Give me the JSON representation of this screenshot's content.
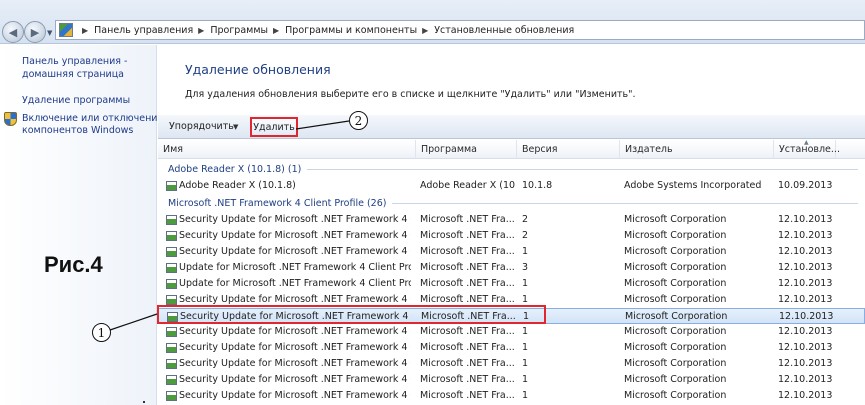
{
  "address_bar": {
    "breadcrumbs": [
      "Панель управления",
      "Программы",
      "Программы и компоненты",
      "Установленные обновления"
    ]
  },
  "sidebar": {
    "home_line1": "Панель управления -",
    "home_line2": "домашняя страница",
    "uninstall": "Удаление программы",
    "features_line1": "Включение или отключение",
    "features_line2": "компонентов Windows"
  },
  "figure_label": "Рис.4",
  "main": {
    "title": "Удаление обновления",
    "description": "Для удаления обновления выберите его в списке и щелкните \"Удалить\" или \"Изменить\"."
  },
  "toolbar": {
    "organize_label": "Упорядочить",
    "delete_label": "Удалить"
  },
  "columns": {
    "name": "Имя",
    "program": "Программа",
    "version": "Версия",
    "publisher": "Издатель",
    "installed": "Установле..."
  },
  "groups": [
    {
      "label": "Adobe Reader X (10.1.8) (1)",
      "rows": [
        {
          "name": "Adobe Reader X (10.1.8)",
          "program": "Adobe Reader X (10...",
          "version": "10.1.8",
          "publisher": "Adobe Systems Incorporated",
          "installed": "10.09.2013"
        }
      ]
    },
    {
      "label": "Microsoft .NET Framework 4 Client Profile (26)",
      "rows": [
        {
          "name": "Security Update for Microsoft .NET Framework 4 Clie...",
          "program": "Microsoft .NET Fra...",
          "version": "2",
          "publisher": "Microsoft Corporation",
          "installed": "12.10.2013"
        },
        {
          "name": "Security Update for Microsoft .NET Framework 4 Clie...",
          "program": "Microsoft .NET Fra...",
          "version": "2",
          "publisher": "Microsoft Corporation",
          "installed": "12.10.2013"
        },
        {
          "name": "Security Update for Microsoft .NET Framework 4 Clie...",
          "program": "Microsoft .NET Fra...",
          "version": "1",
          "publisher": "Microsoft Corporation",
          "installed": "12.10.2013"
        },
        {
          "name": "Update for Microsoft .NET Framework 4 Client Profile...",
          "program": "Microsoft .NET Fra...",
          "version": "3",
          "publisher": "Microsoft Corporation",
          "installed": "12.10.2013"
        },
        {
          "name": "Update for Microsoft .NET Framework 4 Client Profile...",
          "program": "Microsoft .NET Fra...",
          "version": "1",
          "publisher": "Microsoft Corporation",
          "installed": "12.10.2013"
        },
        {
          "name": "Security Update for Microsoft .NET Framework 4 Clie...",
          "program": "Microsoft .NET Fra...",
          "version": "1",
          "publisher": "Microsoft Corporation",
          "installed": "12.10.2013"
        },
        {
          "name": "Security Update for Microsoft .NET Framework 4 Clie...",
          "program": "Microsoft .NET Fra...",
          "version": "1",
          "publisher": "Microsoft Corporation",
          "installed": "12.10.2013",
          "selected": true
        },
        {
          "name": "Security Update for Microsoft .NET Framework 4 Clie...",
          "program": "Microsoft .NET Fra...",
          "version": "1",
          "publisher": "Microsoft Corporation",
          "installed": "12.10.2013"
        },
        {
          "name": "Security Update for Microsoft .NET Framework 4 Clie...",
          "program": "Microsoft .NET Fra...",
          "version": "1",
          "publisher": "Microsoft Corporation",
          "installed": "12.10.2013"
        },
        {
          "name": "Security Update for Microsoft .NET Framework 4 Clie...",
          "program": "Microsoft .NET Fra...",
          "version": "1",
          "publisher": "Microsoft Corporation",
          "installed": "12.10.2013"
        },
        {
          "name": "Security Update for Microsoft .NET Framework 4 Clie...",
          "program": "Microsoft .NET Fra...",
          "version": "1",
          "publisher": "Microsoft Corporation",
          "installed": "12.10.2013"
        },
        {
          "name": "Security Update for Microsoft .NET Framework 4 Clie...",
          "program": "Microsoft .NET Fra...",
          "version": "1",
          "publisher": "Microsoft Corporation",
          "installed": "12.10.2013"
        }
      ]
    }
  ],
  "callouts": {
    "one": "1",
    "two": "2"
  },
  "colors": {
    "annotation_red": "#e0262f",
    "link_blue": "#1e3a8a",
    "title_blue": "#1f3f83"
  },
  "icons": {
    "back": "back-arrow-icon",
    "forward": "forward-arrow-icon",
    "control_panel": "control-panel-icon",
    "shield": "shield-icon",
    "update": "update-icon"
  }
}
